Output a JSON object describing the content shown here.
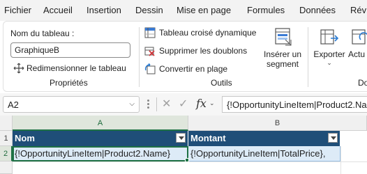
{
  "tabs": [
    "Fichier",
    "Accueil",
    "Insertion",
    "Dessin",
    "Mise en page",
    "Formules",
    "Données",
    "Révis"
  ],
  "ribbon": {
    "properties": {
      "table_name_label": "Nom du tableau :",
      "table_name_value": "GraphiqueB",
      "resize_label": "Redimensionner le tableau",
      "group_label": "Propriétés"
    },
    "tools": {
      "pivot_label": "Tableau croisé dynamique",
      "remove_duplicates_label": "Supprimer les doublons",
      "convert_label": "Convertir en plage",
      "insert_slicer_line1": "Insérer un",
      "insert_slicer_line2": "segment",
      "group_label": "Outils"
    },
    "external": {
      "export_label": "Exporter",
      "refresh_label": "Actu",
      "group_label": "Do"
    }
  },
  "formula_bar": {
    "name_box": "A2",
    "fx": "fx",
    "formula": "{!OpportunityLineItem|Product2.Name}"
  },
  "grid": {
    "columns": [
      "A",
      "B"
    ],
    "rows": [
      "1",
      "2"
    ],
    "header_cells": [
      "Nom",
      "Montant"
    ],
    "data_cells": [
      "{!OpportunityLineItem|Product2.Name}",
      "{!OpportunityLineItem|TotalPrice},"
    ]
  },
  "colors": {
    "table_header": "#1f4e78",
    "table_row": "#ddebf7",
    "selection": "#1e7145"
  }
}
